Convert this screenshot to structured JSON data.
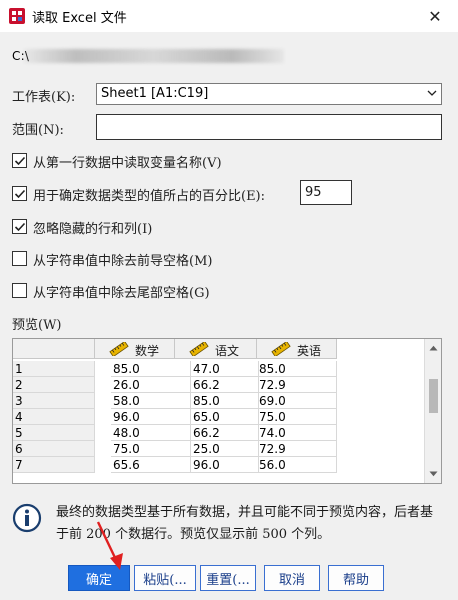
{
  "window": {
    "title": "读取 Excel 文件"
  },
  "path": {
    "text": "C:\\"
  },
  "worksheet": {
    "label": "工作表(K):",
    "value": "Sheet1 [A1:C19]"
  },
  "range": {
    "label": "范围(N):",
    "value": ""
  },
  "options": [
    {
      "label": "从第一行数据中读取变量名称(V)",
      "checked": true
    },
    {
      "label": "用于确定数据类型的值所占的百分比(E):",
      "checked": true,
      "value": "95"
    },
    {
      "label": "忽略隐藏的行和列(I)",
      "checked": true
    },
    {
      "label": "从字符串值中除去前导空格(M)",
      "checked": false
    },
    {
      "label": "从字符串值中除去尾部空格(G)",
      "checked": false
    }
  ],
  "preview": {
    "label": "预览(W)",
    "columns": [
      "数学",
      "语文",
      "英语"
    ],
    "rows": [
      {
        "n": "1",
        "vals": [
          "85.0",
          "47.0",
          "85.0"
        ]
      },
      {
        "n": "2",
        "vals": [
          "26.0",
          "66.2",
          "72.9"
        ]
      },
      {
        "n": "3",
        "vals": [
          "58.0",
          "85.0",
          "69.0"
        ]
      },
      {
        "n": "4",
        "vals": [
          "96.0",
          "65.0",
          "75.0"
        ]
      },
      {
        "n": "5",
        "vals": [
          "48.0",
          "66.2",
          "74.0"
        ]
      },
      {
        "n": "6",
        "vals": [
          "75.0",
          "25.0",
          "72.9"
        ]
      },
      {
        "n": "7",
        "vals": [
          "65.6",
          "96.0",
          "56.0"
        ]
      }
    ]
  },
  "info": {
    "text": "最终的数据类型基于所有数据，并且可能不同于预览内容，后者基于前 200 个数据行。预览仅显示前 500 个列。"
  },
  "buttons": {
    "ok": "确定",
    "paste": "粘贴(...",
    "reset": "重置(...",
    "cancel": "取消",
    "help": "帮助"
  },
  "colors": {
    "accent": "#1f6fe0",
    "arrow": "#e02020"
  }
}
